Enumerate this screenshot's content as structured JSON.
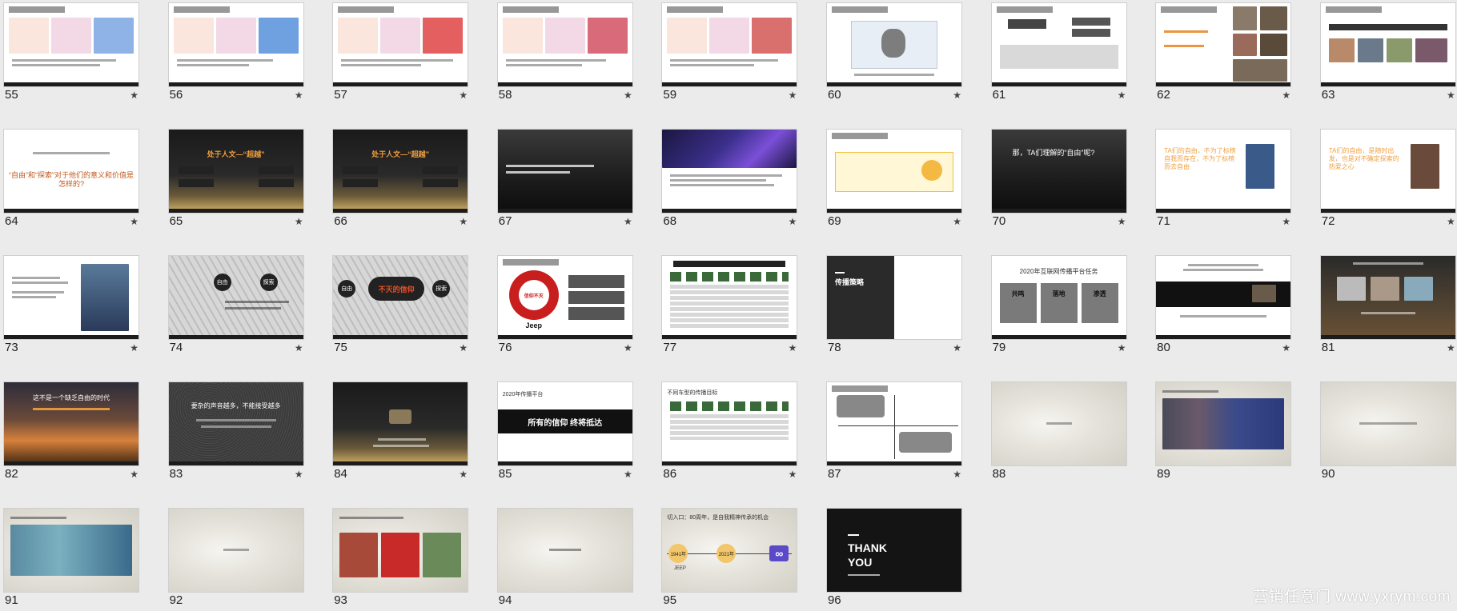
{
  "slides": [
    {
      "number": "55",
      "style": "chart"
    },
    {
      "number": "56",
      "style": "chart"
    },
    {
      "number": "57",
      "style": "chart"
    },
    {
      "number": "58",
      "style": "chart"
    },
    {
      "number": "59",
      "style": "chart"
    },
    {
      "number": "60",
      "style": "diagram"
    },
    {
      "number": "61",
      "style": "diagram2"
    },
    {
      "number": "62",
      "style": "collage"
    },
    {
      "number": "63",
      "style": "collage"
    },
    {
      "number": "64",
      "style": "text"
    },
    {
      "number": "65",
      "style": "road"
    },
    {
      "number": "66",
      "style": "road"
    },
    {
      "number": "67",
      "style": "photo-dark"
    },
    {
      "number": "68",
      "style": "concert"
    },
    {
      "number": "69",
      "style": "table"
    },
    {
      "number": "70",
      "style": "photo-dark"
    },
    {
      "number": "71",
      "style": "magazine"
    },
    {
      "number": "72",
      "style": "magazine"
    },
    {
      "number": "73",
      "style": "person"
    },
    {
      "number": "74",
      "style": "grid"
    },
    {
      "number": "75",
      "style": "grid"
    },
    {
      "number": "76",
      "style": "circle"
    },
    {
      "number": "77",
      "style": "table"
    },
    {
      "number": "78",
      "style": "split-dark"
    },
    {
      "number": "79",
      "style": "boxes"
    },
    {
      "number": "80",
      "style": "video"
    },
    {
      "number": "81",
      "style": "photo-dark"
    },
    {
      "number": "82",
      "style": "sunset"
    },
    {
      "number": "83",
      "style": "noise"
    },
    {
      "number": "84",
      "style": "road-night"
    },
    {
      "number": "85",
      "style": "banner"
    },
    {
      "number": "86",
      "style": "table"
    },
    {
      "number": "87",
      "style": "quadrant"
    },
    {
      "number": "88",
      "style": "sand"
    },
    {
      "number": "89",
      "style": "sand-photo"
    },
    {
      "number": "90",
      "style": "sand"
    },
    {
      "number": "91",
      "style": "sand-photo"
    },
    {
      "number": "92",
      "style": "sand"
    },
    {
      "number": "93",
      "style": "sand-photo"
    },
    {
      "number": "94",
      "style": "sand"
    },
    {
      "number": "95",
      "style": "timeline"
    },
    {
      "number": "96",
      "style": "thankyou"
    }
  ],
  "texts": {
    "slide64_line": "“自由”和“探索”对于他们的意义和价值是怎样的?",
    "slide65_title": "处于人文—“超越”",
    "slide66_title": "处于人文—“超越”",
    "slide70_title": "那，TA们理解的“自由”呢?",
    "slide71_title": "TA们的自由，不为了标榜自我而存在，不为了标榜而去自由",
    "slide72_title": "TA们的自由，是随时出发，也是对不确定探索的热爱之心",
    "slide74_left": "自由",
    "slide74_right": "探索",
    "slide75_left": "自由",
    "slide75_mid": "不灭的信仰",
    "slide75_right": "探索",
    "slide76_center": "信仰不灭",
    "slide76_brand": "Jeep",
    "slide78_title": "传播策略",
    "slide79_title": "2020年互联网传播平台任务",
    "slide79_box1": "共鸣",
    "slide79_box2": "落地",
    "slide79_box3": "渗透",
    "slide82_title": "这不是一个缺乏自由的时代",
    "slide83_title": "要杂的声音越多，不能接受越多",
    "slide85_top": "2020年传播平台",
    "slide85_banner": "所有的信仰 终将抵达",
    "slide86_title": "不同车型的传播目标",
    "slide95_title": "切入口：80周年，是自我精神传承的机会",
    "slide95_year1": "1941年",
    "slide95_year2": "2021年",
    "slide95_label": "JEEP",
    "slide96_line1": "THANK",
    "slide96_line2": "YOU"
  },
  "watermark": "营销任意门 www.yxrym.com",
  "star_icon": "★"
}
